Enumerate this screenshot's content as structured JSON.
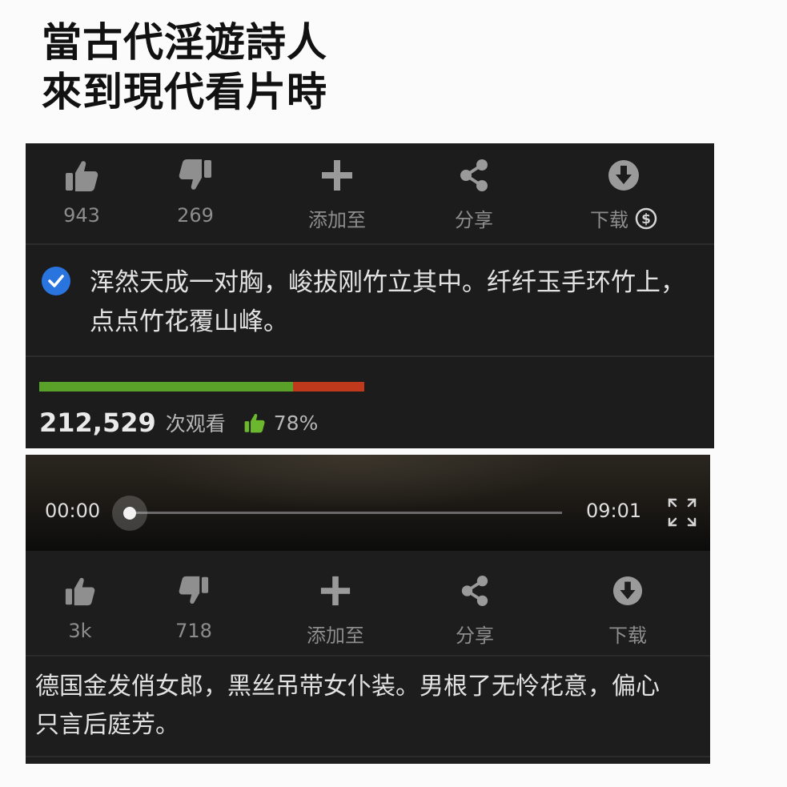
{
  "caption": {
    "line1": "當古代淫遊詩人",
    "line2": "來到現代看片時"
  },
  "panel1": {
    "actions": [
      {
        "icon": "thumbs-up-icon",
        "label": "943"
      },
      {
        "icon": "thumbs-down-icon",
        "label": "269"
      },
      {
        "icon": "plus-icon",
        "label": "添加至"
      },
      {
        "icon": "share-icon",
        "label": "分享"
      },
      {
        "icon": "download-icon",
        "label": "下载",
        "badge": "dollar-icon"
      }
    ],
    "description": "浑然天成一对胸，峻拔刚竹立其中。纤纤玉手环竹上，点点竹花覆山峰。",
    "rating_ratio": 0.78,
    "views": "212,529",
    "views_label": "次观看",
    "rating_percent": "78%",
    "colors": {
      "good": "#5aa12a",
      "bad": "#c0391d",
      "verified": "#2a74e0"
    }
  },
  "panel2": {
    "player": {
      "current_time": "00:00",
      "duration": "09:01",
      "progress": 0
    },
    "actions": [
      {
        "icon": "thumbs-up-icon",
        "label": "3k"
      },
      {
        "icon": "thumbs-down-icon",
        "label": "718"
      },
      {
        "icon": "plus-icon",
        "label": "添加至"
      },
      {
        "icon": "share-icon",
        "label": "分享"
      },
      {
        "icon": "download-icon",
        "label": "下载"
      }
    ],
    "description": "德国金发俏女郎，黑丝吊带女仆装。男根了无怜花意，偏心只言后庭芳。"
  }
}
